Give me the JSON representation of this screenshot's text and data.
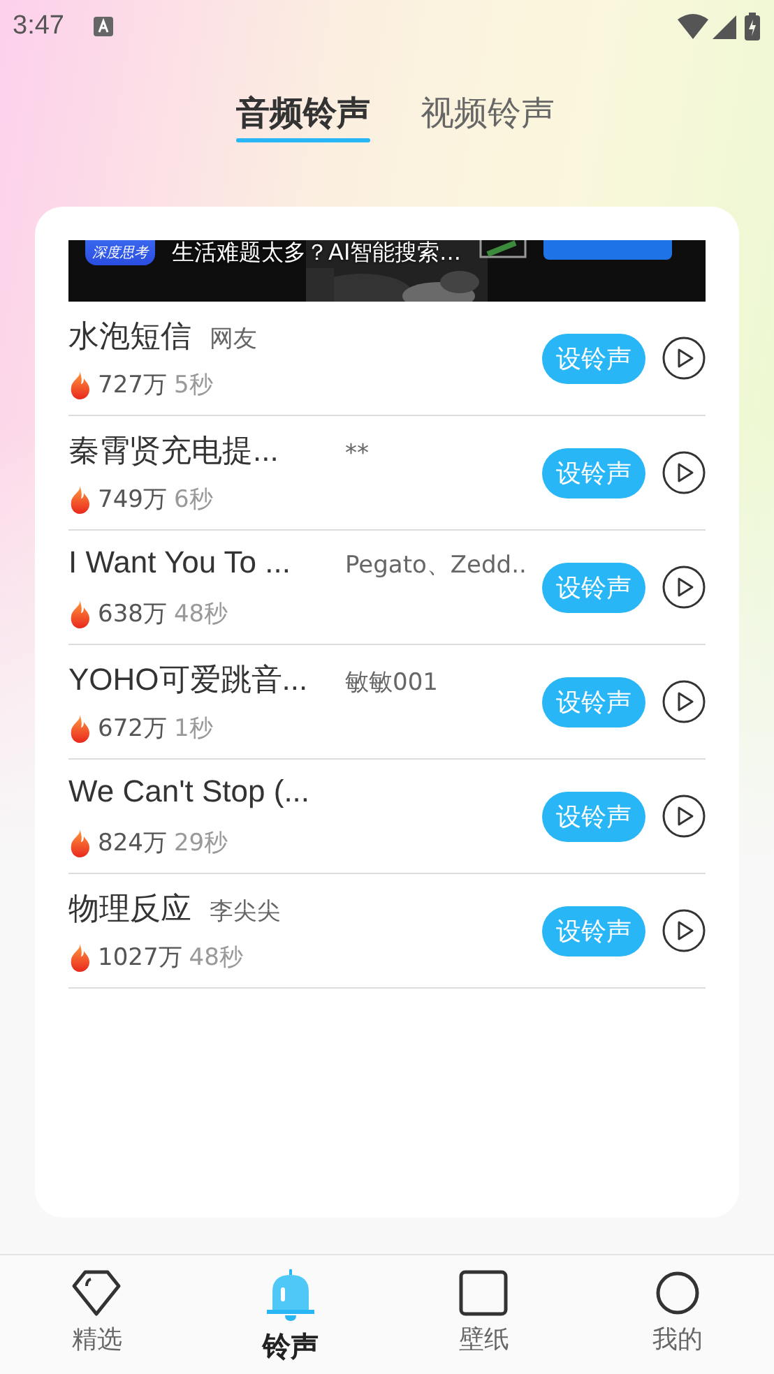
{
  "status_bar": {
    "time": "3:47"
  },
  "tabs": [
    {
      "label": "音频铃声",
      "selected": true
    },
    {
      "label": "视频铃声",
      "selected": false
    }
  ],
  "ad": {
    "app_name": "深度思考",
    "text": "生活难题太多？AI智能搜索..."
  },
  "ringtones": [
    {
      "title": "水泡短信",
      "author": "网友",
      "plays": "727万",
      "duration": "5秒",
      "button": "设铃声"
    },
    {
      "title": "秦霄贤充电提...",
      "author": "**",
      "plays": "749万",
      "duration": "6秒",
      "button": "设铃声"
    },
    {
      "title": "I Want You To ...",
      "author": "Pegato、Zedd..",
      "plays": "638万",
      "duration": "48秒",
      "button": "设铃声"
    },
    {
      "title": "YOHO可爱跳音...",
      "author": "敏敏001",
      "plays": "672万",
      "duration": "1秒",
      "button": "设铃声"
    },
    {
      "title": "We Can't Stop (...",
      "plays": "824万",
      "duration": "29秒",
      "button": "设铃声"
    },
    {
      "title": "物理反应",
      "author": "李尖尖",
      "plays": "1027万",
      "duration": "48秒",
      "button": "设铃声"
    }
  ],
  "bottom_nav": [
    {
      "kind": "diamond",
      "label": "精选",
      "selected": false
    },
    {
      "kind": "bell",
      "label": "铃声",
      "selected": true
    },
    {
      "kind": "frame",
      "label": "壁纸",
      "selected": false
    },
    {
      "kind": "user",
      "label": "我的",
      "selected": false
    }
  ]
}
